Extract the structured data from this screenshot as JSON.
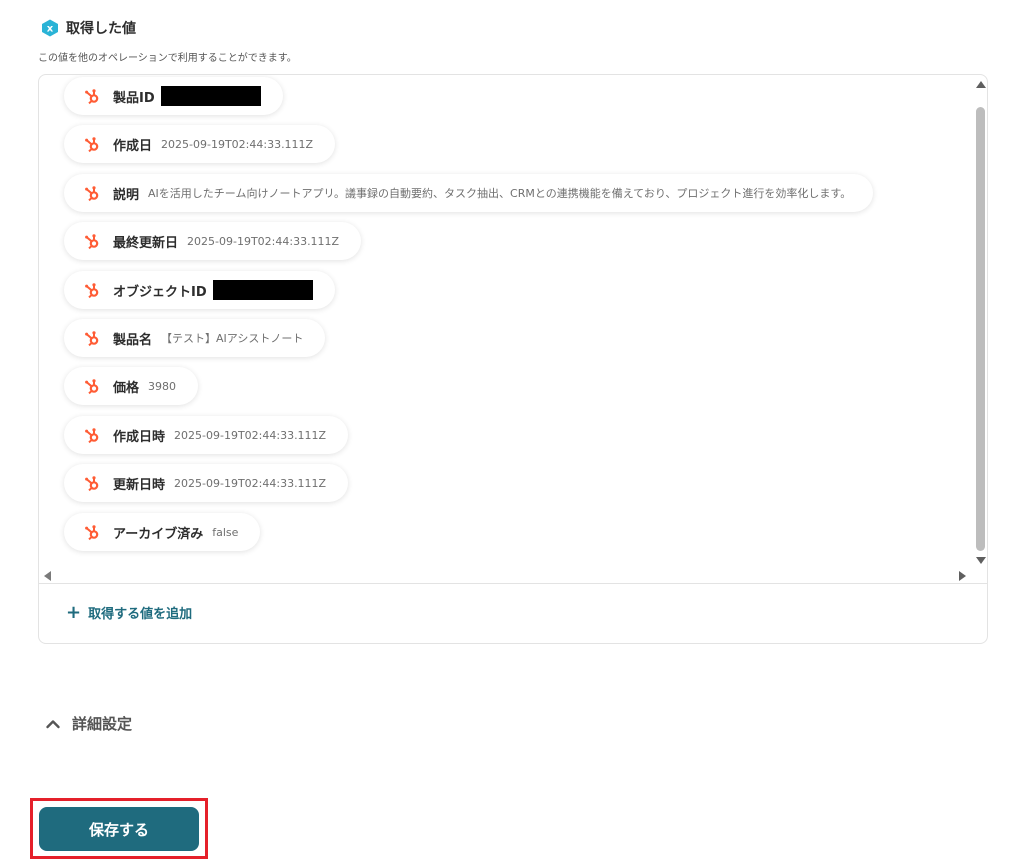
{
  "section": {
    "title": "取得した値",
    "subtitle": "この値を他のオペレーションで利用することができます。"
  },
  "values": [
    {
      "label": "製品ID",
      "value": "",
      "redacted": true
    },
    {
      "label": "作成日",
      "value": "2025-09-19T02:44:33.111Z"
    },
    {
      "label": "説明",
      "value": "AIを活用したチーム向けノートアプリ。議事録の自動要約、タスク抽出、CRMとの連携機能を備えており、プロジェクト進行を効率化します。"
    },
    {
      "label": "最終更新日",
      "value": "2025-09-19T02:44:33.111Z"
    },
    {
      "label": "オブジェクトID",
      "value": "",
      "redacted": true
    },
    {
      "label": "製品名",
      "value": "【テスト】AIアシストノート"
    },
    {
      "label": "価格",
      "value": "3980"
    },
    {
      "label": "作成日時",
      "value": "2025-09-19T02:44:33.111Z"
    },
    {
      "label": "更新日時",
      "value": "2025-09-19T02:44:33.111Z"
    },
    {
      "label": "アーカイブ済み",
      "value": "false"
    }
  ],
  "add_value_label": "取得する値を追加",
  "advanced_settings_label": "詳細設定",
  "save_button_label": "保存する",
  "colors": {
    "accent": "#1f6b7e",
    "hubspot_orange": "#ff5c35",
    "header_icon": "#2ab3d6",
    "highlight_border": "#e5202a"
  },
  "icons": {
    "header": "yoom-x-badge-icon",
    "value_chip": "hubspot-icon",
    "add": "plus-icon",
    "advanced": "chevron-up-icon"
  }
}
